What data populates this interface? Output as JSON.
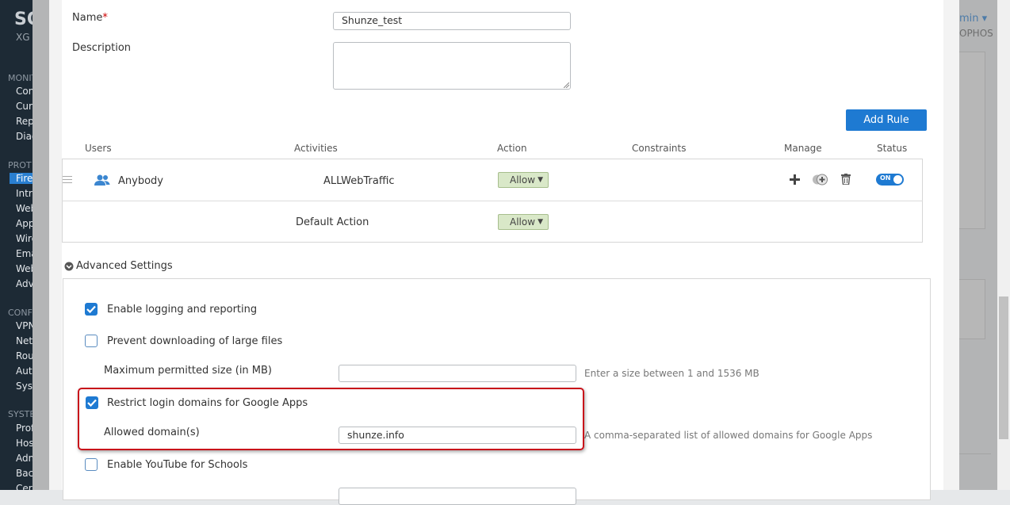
{
  "form": {
    "name_label": "Name",
    "name_required": "*",
    "name_value": "Shunze_test",
    "description_label": "Description",
    "description_value": ""
  },
  "rules": {
    "add_rule_label": "Add Rule",
    "headers": [
      "Users",
      "Activities",
      "Action",
      "Constraints",
      "Manage",
      "Status"
    ],
    "row": {
      "user": "Anybody",
      "activity": "ALLWebTraffic",
      "action": "Allow",
      "status": "ON"
    },
    "default_action_label": "Default Action",
    "default_action_value": "Allow"
  },
  "advanced": {
    "title": "Advanced Settings",
    "enable_logging_label": "Enable logging and reporting",
    "enable_logging_checked": true,
    "prevent_download_label": "Prevent downloading of large files",
    "prevent_download_checked": false,
    "max_size_label": "Maximum permitted size (in MB)",
    "max_size_value": "",
    "max_size_hint": "Enter a size between 1 and 1536 MB",
    "restrict_domains_label": "Restrict login domains for Google Apps",
    "restrict_domains_checked": true,
    "allowed_domains_label": "Allowed domain(s)",
    "allowed_domains_value": "shunze.info",
    "allowed_domains_hint": "A comma-separated list of allowed domains for Google Apps",
    "youtube_label": "Enable YouTube for Schools",
    "youtube_checked": false
  },
  "background": {
    "logo": "SO",
    "logo_sub": "XG",
    "sections": [
      "MONIT",
      "PROT",
      "CONF",
      "SYSTE"
    ],
    "items_monitor": [
      "Con",
      "Curr",
      "Rep",
      "Diag"
    ],
    "items_protect": [
      "Fire",
      "Intru",
      "Web",
      "App",
      "Wire",
      "Ema",
      "Web",
      "Adv"
    ],
    "items_configure": [
      "VPN",
      "Netv",
      "Rou",
      "Auth",
      "Syst"
    ],
    "items_system": [
      "Prof",
      "Hos",
      "Adm",
      "Bac",
      "Cert"
    ],
    "admin_label": "min ▾",
    "brand": "OPHOS"
  },
  "colors": {
    "accent": "#1e7ad2",
    "allow_bg": "#d9e8c8",
    "highlight": "#c8111a"
  }
}
